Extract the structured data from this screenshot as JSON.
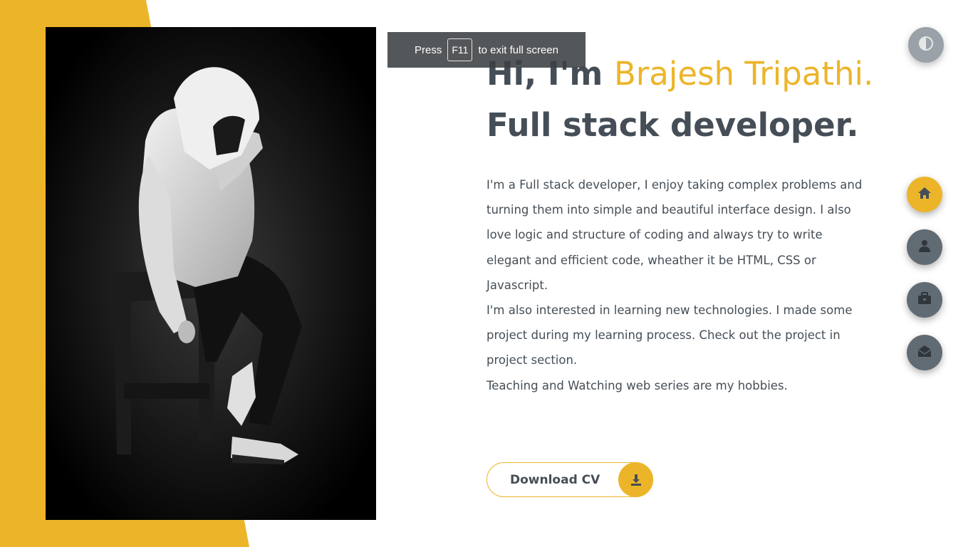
{
  "colors": {
    "accent": "#ecb529",
    "text": "#454e56",
    "nav_inactive": "#616b74",
    "toggle": "#9aa1a8"
  },
  "fullscreen_notice": {
    "before": "Press",
    "key": "F11",
    "after": "to exit full screen"
  },
  "hero": {
    "title_part1": "Hi, I'm ",
    "title_name": "Brajesh Tripathi.",
    "title_part2": " Full stack developer.",
    "paragraphs": [
      "I'm a Full stack developer, I enjoy taking complex problems and turning them into simple and beautiful interface design. I also love logic and structure of coding and always try to write elegant and efficient code, wheather it be HTML, CSS or Javascript.",
      "I'm also interested in learning new technologies. I made some project during my learning process. Check out the project in project section.",
      "Teaching and Watching web series are my hobbies."
    ],
    "cv_button_label": "Download CV"
  },
  "icons": {
    "theme_toggle": "half-circle-icon",
    "download": "download-icon",
    "nav": [
      "home-icon",
      "user-icon",
      "briefcase-icon",
      "envelope-open-icon"
    ]
  }
}
